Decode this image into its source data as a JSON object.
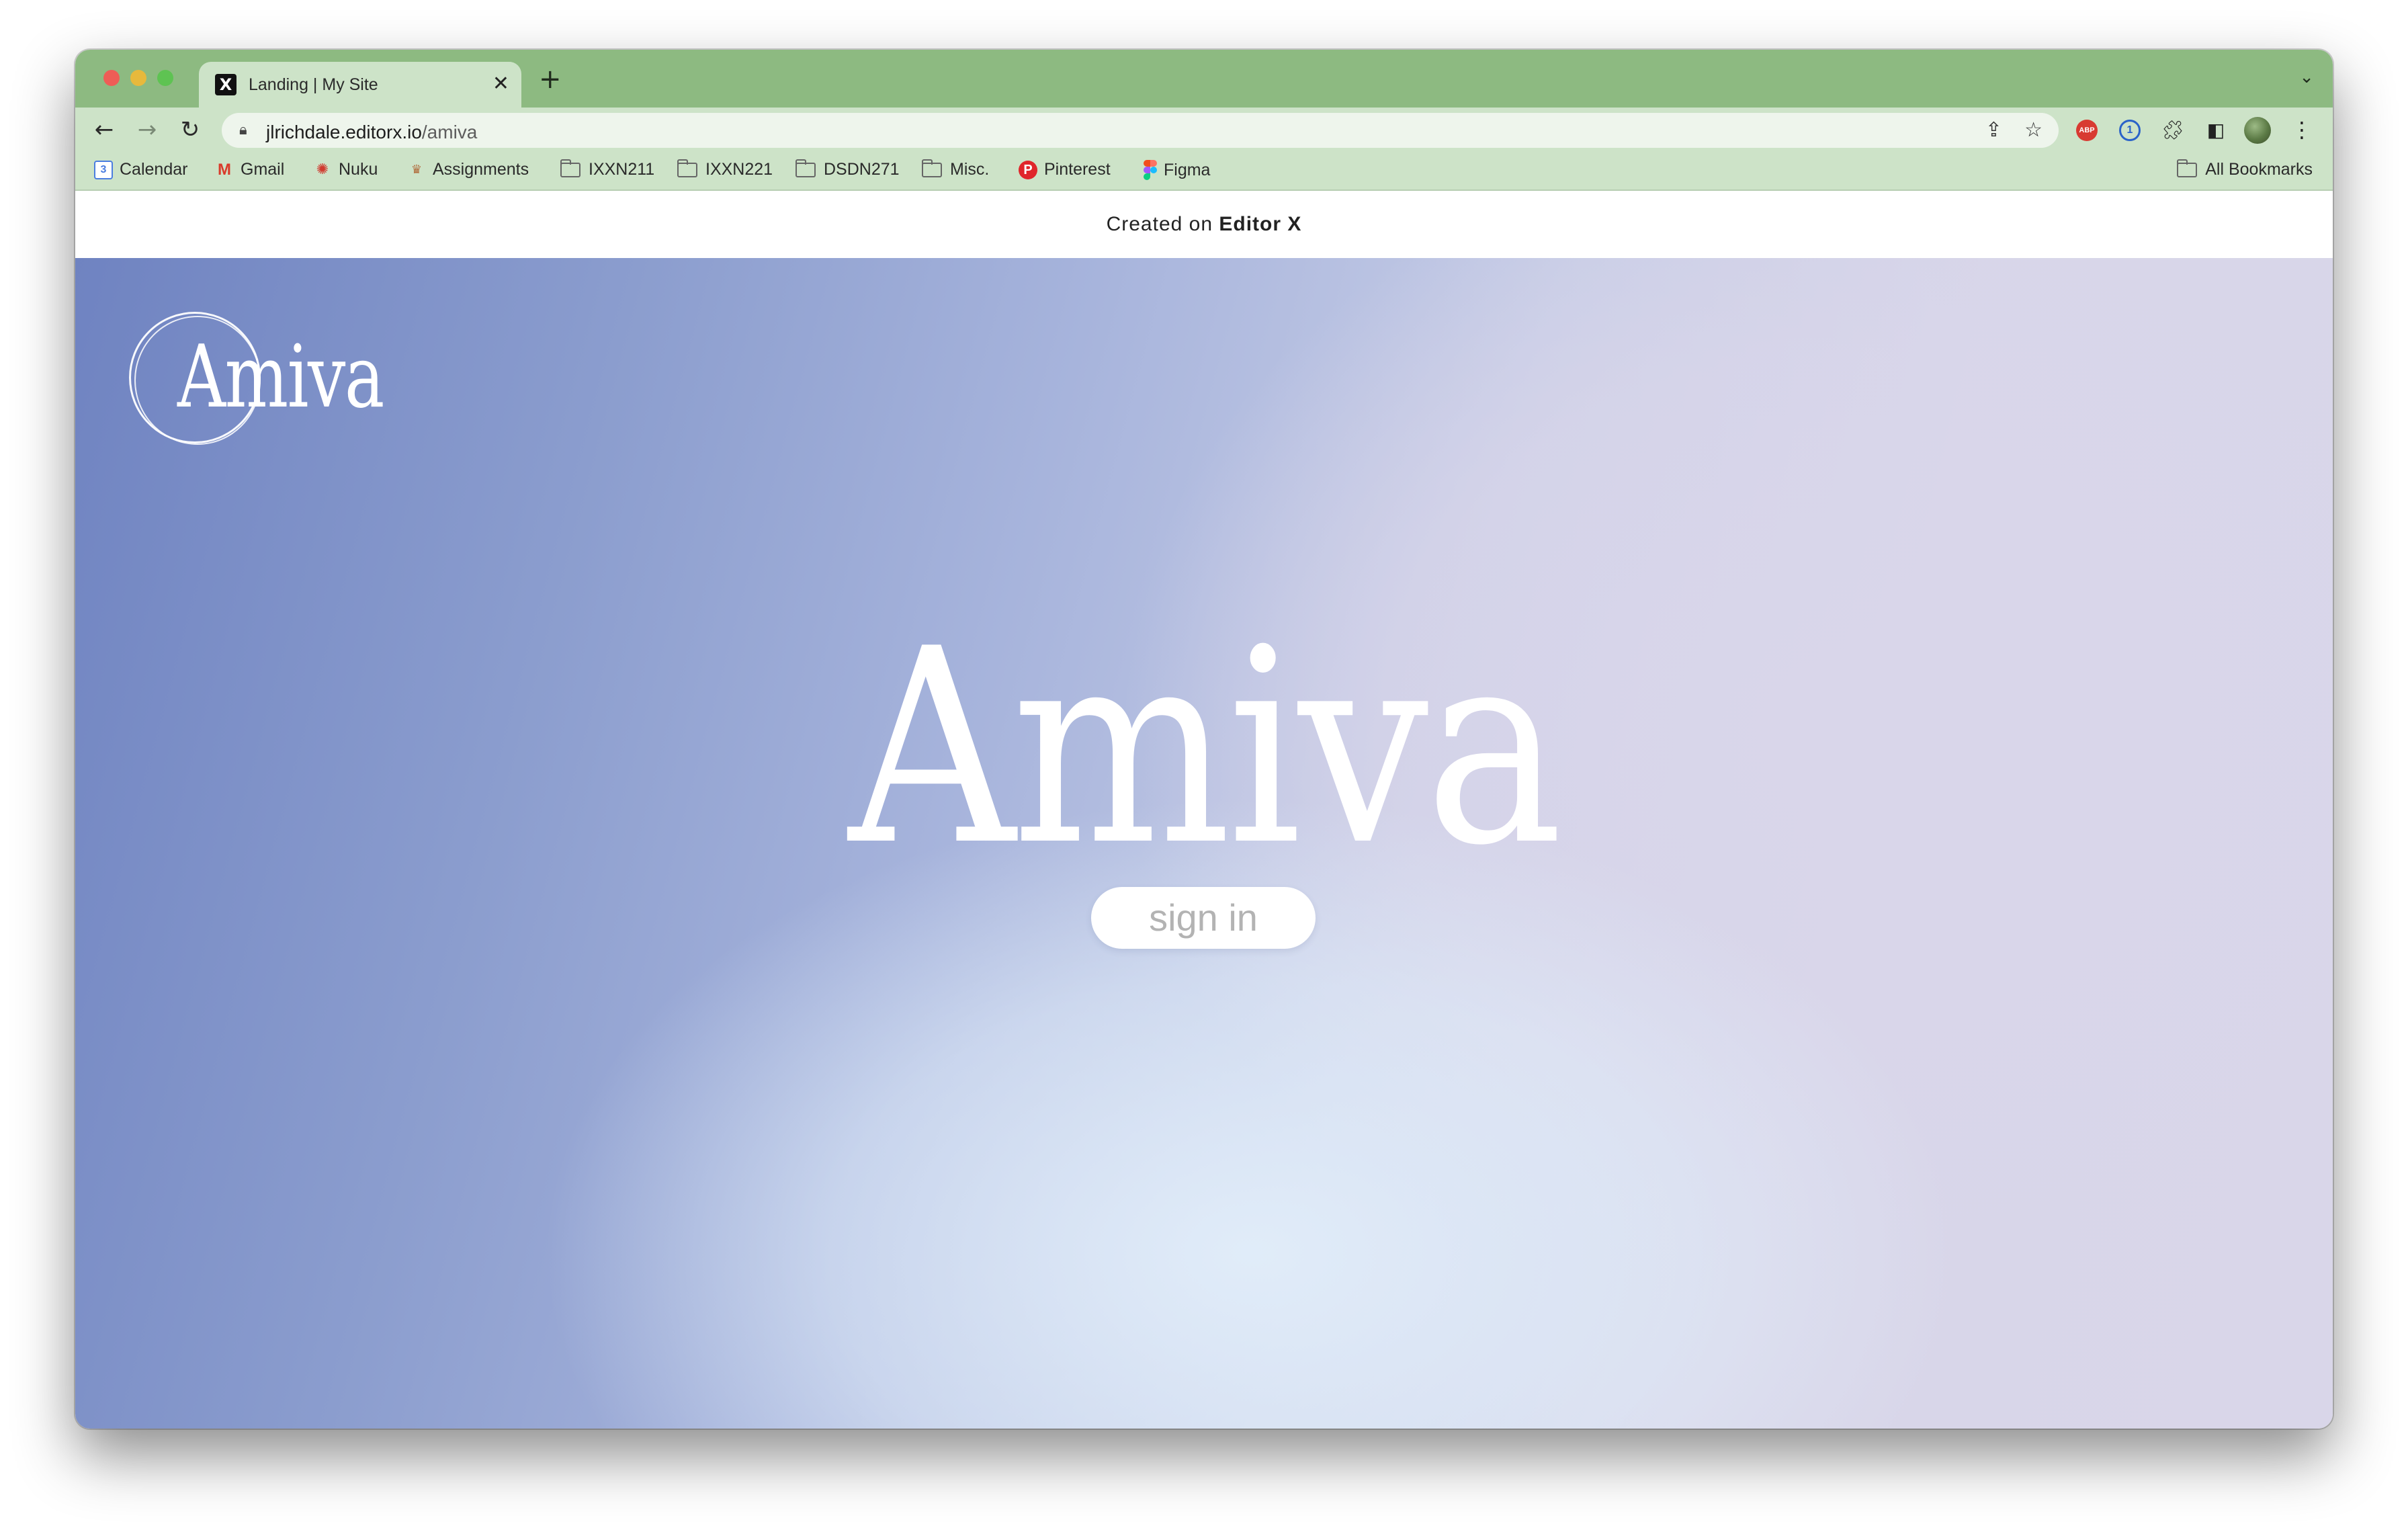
{
  "browser": {
    "tab": {
      "title": "Landing | My Site",
      "favicon": "X",
      "close": "✕"
    },
    "new_tab": "+",
    "tab_menu": "⌄",
    "url_host": "jlrichdale.editorx.io",
    "url_path": "/amiva",
    "extensions": {
      "abp": "ABP",
      "onepassword": "1"
    },
    "bookmarks": [
      {
        "label": "Calendar",
        "icon": "calendar-icon",
        "glyph": "3"
      },
      {
        "label": "Gmail",
        "icon": "gmail-icon",
        "glyph": "M"
      },
      {
        "label": "Nuku",
        "icon": "nuku-icon",
        "glyph": "✺"
      },
      {
        "label": "Assignments",
        "icon": "assignments-icon",
        "glyph": "♛"
      },
      {
        "label": "IXXN211",
        "icon": "folder-icon"
      },
      {
        "label": "IXXN221",
        "icon": "folder-icon"
      },
      {
        "label": "DSDN271",
        "icon": "folder-icon"
      },
      {
        "label": "Misc.",
        "icon": "folder-icon"
      },
      {
        "label": "Pinterest",
        "icon": "pinterest-icon",
        "glyph": "P"
      },
      {
        "label": "Figma",
        "icon": "figma-icon"
      }
    ],
    "all_bookmarks": "All Bookmarks"
  },
  "site": {
    "banner_prefix": "Created on ",
    "banner_brand": "Editor X",
    "logo_text": "Amiva",
    "hero_title": "Amiva",
    "signin_label": "sign in"
  }
}
